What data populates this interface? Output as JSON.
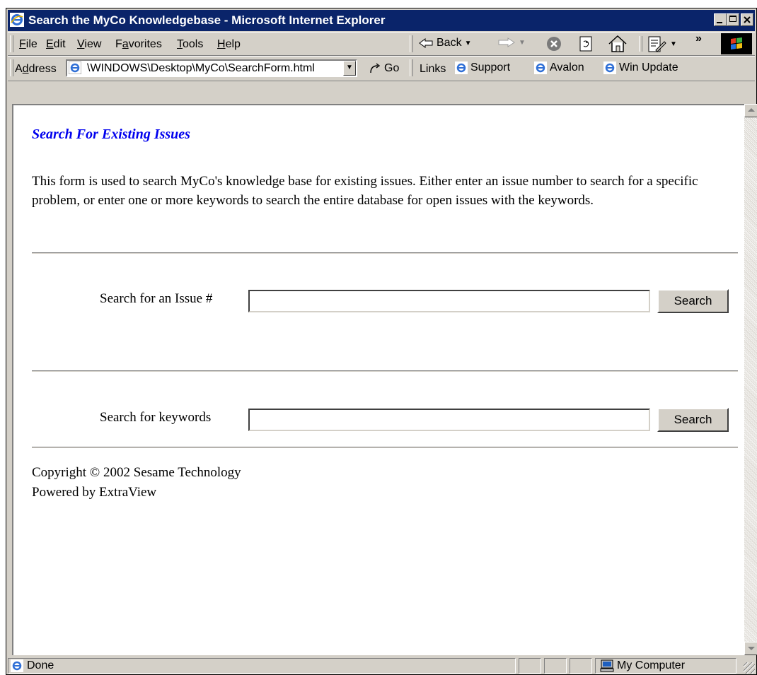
{
  "window": {
    "title": "Search the MyCo Knowledgebase - Microsoft Internet Explorer"
  },
  "menu": [
    {
      "prefix": "",
      "key": "F",
      "rest": "ile"
    },
    {
      "prefix": "",
      "key": "E",
      "rest": "dit"
    },
    {
      "prefix": "",
      "key": "V",
      "rest": "iew"
    },
    {
      "prefix": "F",
      "key": "a",
      "rest": "vorites"
    },
    {
      "prefix": "",
      "key": "T",
      "rest": "ools"
    },
    {
      "prefix": "",
      "key": "H",
      "rest": "elp"
    }
  ],
  "toolbar": {
    "back_label": "Back",
    "chevron": "»"
  },
  "address_bar": {
    "label_prefix": "A",
    "label_key": "d",
    "label_rest": "dress",
    "url": "\\WINDOWS\\Desktop\\MyCo\\SearchForm.html",
    "go_label": "Go"
  },
  "links": {
    "label": "Links",
    "items": [
      "Support",
      "Avalon",
      "Win Update"
    ]
  },
  "page": {
    "heading": "Search For Existing Issues",
    "intro": "This form is used to search MyCo's knowledge base for existing issues. Either enter an issue number to search for a specific problem, or enter one or more keywords to search the entire database for open issues with the keywords.",
    "issue_search": {
      "label": "Search for an Issue #",
      "value": "",
      "button": "Search"
    },
    "keyword_search": {
      "label": "Search for keywords",
      "value": "",
      "button": "Search"
    },
    "footer": {
      "copyright": "Copyright © 2002 Sesame Technology",
      "powered": "Powered by ExtraView"
    }
  },
  "status": {
    "text": "Done",
    "zone": "My Computer"
  },
  "colors": {
    "titlebar": "#0a246a",
    "chrome": "#d4d0c8",
    "heading": "#0000ee"
  },
  "icons": [
    "ie-icon",
    "minimize-icon",
    "maximize-icon",
    "close-icon",
    "back-arrow-icon",
    "forward-arrow-icon",
    "stop-icon",
    "refresh-icon",
    "home-icon",
    "edit-icon",
    "windows-logo-icon",
    "go-arrow-icon",
    "page-ie-icon",
    "my-computer-icon"
  ]
}
